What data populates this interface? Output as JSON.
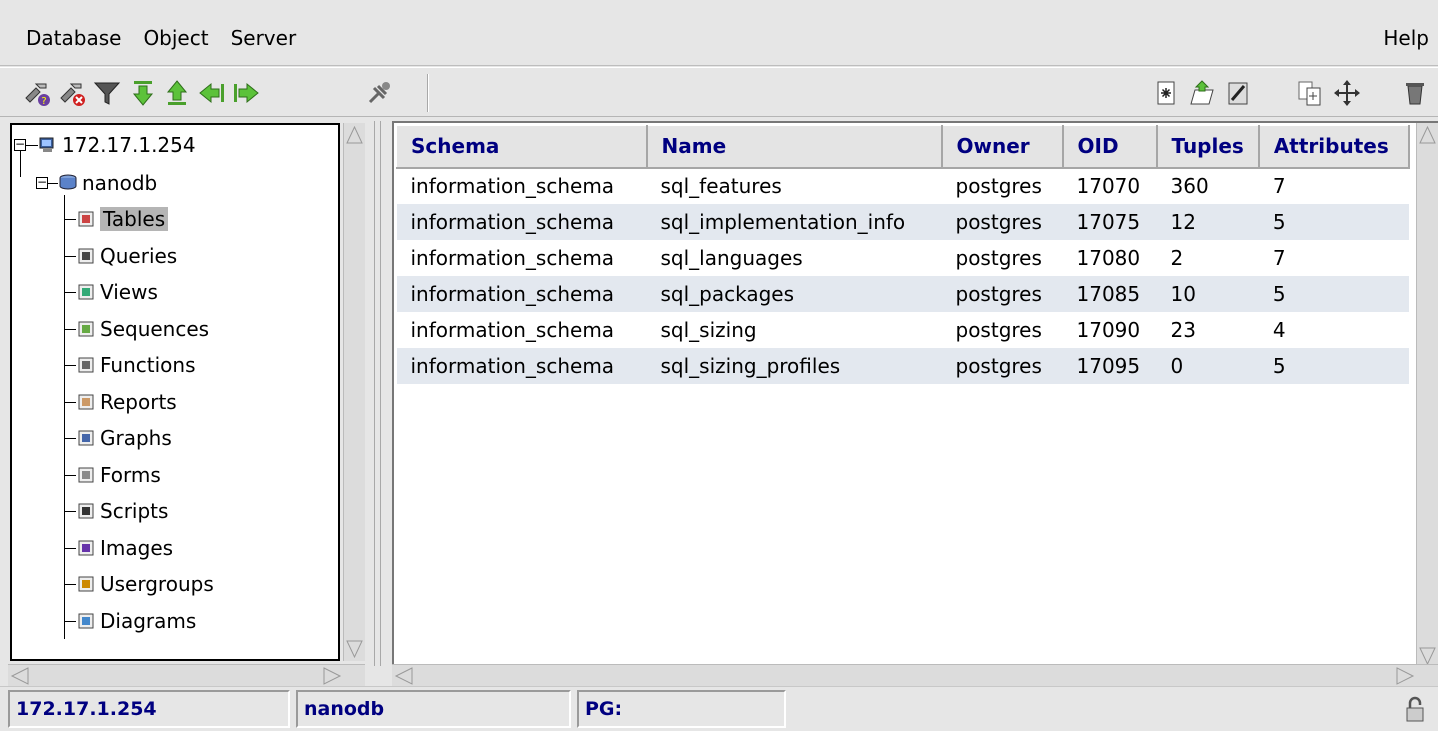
{
  "menu": {
    "left": [
      "Database",
      "Object",
      "Server"
    ],
    "help": "Help"
  },
  "toolbar": {
    "left_icons": [
      "connect-icon",
      "disconnect-icon",
      "filter-icon",
      "arrow-down-icon",
      "arrow-up-icon",
      "arrow-left-icon",
      "arrow-right-icon",
      "tools-icon"
    ],
    "right_icons": [
      "new-object-icon",
      "open-object-icon",
      "edit-object-icon",
      "copy-object-icon",
      "move-object-icon",
      "delete-object-icon"
    ]
  },
  "tree": {
    "server": "172.17.1.254",
    "database": "nanodb",
    "items": [
      {
        "label": "Tables",
        "icon": "tables-icon",
        "selected": true
      },
      {
        "label": "Queries",
        "icon": "queries-icon"
      },
      {
        "label": "Views",
        "icon": "views-icon"
      },
      {
        "label": "Sequences",
        "icon": "sequences-icon"
      },
      {
        "label": "Functions",
        "icon": "functions-icon"
      },
      {
        "label": "Reports",
        "icon": "reports-icon"
      },
      {
        "label": "Graphs",
        "icon": "graphs-icon"
      },
      {
        "label": "Forms",
        "icon": "forms-icon"
      },
      {
        "label": "Scripts",
        "icon": "scripts-icon"
      },
      {
        "label": "Images",
        "icon": "images-icon"
      },
      {
        "label": "Usergroups",
        "icon": "usergroups-icon"
      },
      {
        "label": "Diagrams",
        "icon": "diagrams-icon"
      }
    ]
  },
  "table": {
    "columns": [
      "Schema",
      "Name",
      "Owner",
      "OID",
      "Tuples",
      "Attributes"
    ],
    "rows": [
      [
        "information_schema",
        "sql_features",
        "postgres",
        "17070",
        "360",
        "7"
      ],
      [
        "information_schema",
        "sql_implementation_info",
        "postgres",
        "17075",
        "12",
        "5"
      ],
      [
        "information_schema",
        "sql_languages",
        "postgres",
        "17080",
        "2",
        "7"
      ],
      [
        "information_schema",
        "sql_packages",
        "postgres",
        "17085",
        "10",
        "5"
      ],
      [
        "information_schema",
        "sql_sizing",
        "postgres",
        "17090",
        "23",
        "4"
      ],
      [
        "information_schema",
        "sql_sizing_profiles",
        "postgres",
        "17095",
        "0",
        "5"
      ]
    ]
  },
  "status": {
    "host": "172.17.1.254",
    "database": "nanodb",
    "pg": "PG:"
  },
  "colors": {
    "header_text": "#000080",
    "alt_row": "#e3e8ef",
    "background": "#e6e6e6"
  }
}
